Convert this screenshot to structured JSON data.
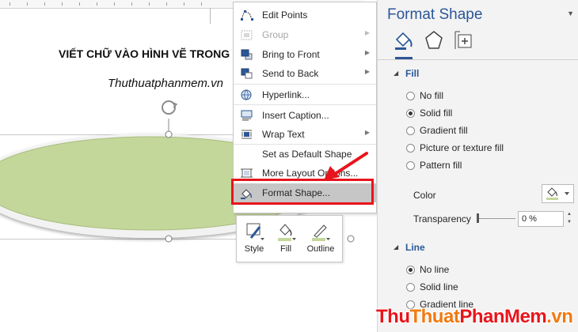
{
  "document": {
    "heading": "VIẾT CHỮ VÀO HÌNH VẼ TRONG",
    "site": "Thuthuatphanmem.vn"
  },
  "context_menu": {
    "items": [
      {
        "label": "Edit Points",
        "icon": "edit-points-icon",
        "enabled": true,
        "submenu": false
      },
      {
        "label": "Group",
        "icon": "group-icon",
        "enabled": false,
        "submenu": true
      },
      {
        "label": "Bring to Front",
        "icon": "bring-to-front-icon",
        "enabled": true,
        "submenu": true
      },
      {
        "label": "Send to Back",
        "icon": "send-to-back-icon",
        "enabled": true,
        "submenu": true
      },
      {
        "label": "Hyperlink...",
        "icon": "hyperlink-icon",
        "enabled": true,
        "submenu": false
      },
      {
        "label": "Insert Caption...",
        "icon": "insert-caption-icon",
        "enabled": true,
        "submenu": false
      },
      {
        "label": "Wrap Text",
        "icon": "wrap-text-icon",
        "enabled": true,
        "submenu": true
      },
      {
        "label": "Set as Default Shape",
        "icon": "",
        "enabled": true,
        "submenu": false
      },
      {
        "label": "More Layout Options...",
        "icon": "layout-options-icon",
        "enabled": true,
        "submenu": false
      },
      {
        "label": "Format Shape...",
        "icon": "format-shape-icon",
        "enabled": true,
        "submenu": false,
        "highlighted": true
      }
    ]
  },
  "mini_toolbar": {
    "style": "Style",
    "fill": "Fill",
    "outline": "Outline"
  },
  "panel": {
    "title": "Format Shape",
    "tabs": [
      "fill-line-icon",
      "effects-icon",
      "size-properties-icon"
    ],
    "fill_section": "Fill",
    "fill_options": [
      {
        "label": "No fill",
        "selected": false
      },
      {
        "label": "Solid fill",
        "selected": true
      },
      {
        "label": "Gradient fill",
        "selected": false
      },
      {
        "label": "Picture or texture fill",
        "selected": false
      },
      {
        "label": "Pattern fill",
        "selected": false
      }
    ],
    "color_label": "Color",
    "transparency_label": "Transparency",
    "transparency_value": "0 %",
    "line_section": "Line",
    "line_options": [
      {
        "label": "No line",
        "selected": true
      },
      {
        "label": "Solid line",
        "selected": false
      },
      {
        "label": "Gradient line",
        "selected": false
      }
    ]
  },
  "watermark": {
    "part1": "Thu",
    "part2": "Thuat",
    "part3": "PhanMem",
    "part4": ".vn"
  },
  "colors": {
    "accent": "#2b5797",
    "highlight_red": "#e8141b",
    "shape_fill": "#c4d79b",
    "menu_hover": "#c6c6c6"
  }
}
